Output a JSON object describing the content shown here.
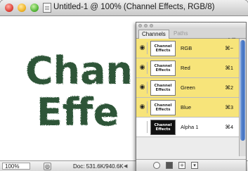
{
  "window": {
    "title": "Untitled-1 @ 100% (Channel Effects, RGB/8)",
    "buttons": [
      "close",
      "minimize",
      "zoom"
    ]
  },
  "canvas": {
    "text_line1": "Chan",
    "text_line2": "Effe",
    "text_color": "#2e5537"
  },
  "statusbar": {
    "zoom": "100%",
    "doc_size": "Doc: 531.6K/940.6K"
  },
  "channels_panel": {
    "tabs": [
      {
        "label": "Channels",
        "active": true
      },
      {
        "label": "Paths",
        "active": false
      }
    ],
    "rows": [
      {
        "name": "RGB",
        "shortcut": "⌘~",
        "selected": true,
        "visible": true,
        "thumb": "Channel Effects"
      },
      {
        "name": "Red",
        "shortcut": "⌘1",
        "selected": true,
        "visible": true,
        "thumb": "Channel Effects"
      },
      {
        "name": "Green",
        "shortcut": "⌘2",
        "selected": true,
        "visible": true,
        "thumb": "Channel Effects"
      },
      {
        "name": "Blue",
        "shortcut": "⌘3",
        "selected": true,
        "visible": true,
        "thumb": "Channel Effects"
      },
      {
        "name": "Alpha 1",
        "shortcut": "⌘4",
        "selected": false,
        "visible": false,
        "thumb": "Channel Effects"
      }
    ],
    "selected_color": "#f7e47a",
    "bottom_icons": [
      "load-selection-icon",
      "save-selection-icon",
      "new-channel-icon",
      "trash-icon"
    ]
  }
}
